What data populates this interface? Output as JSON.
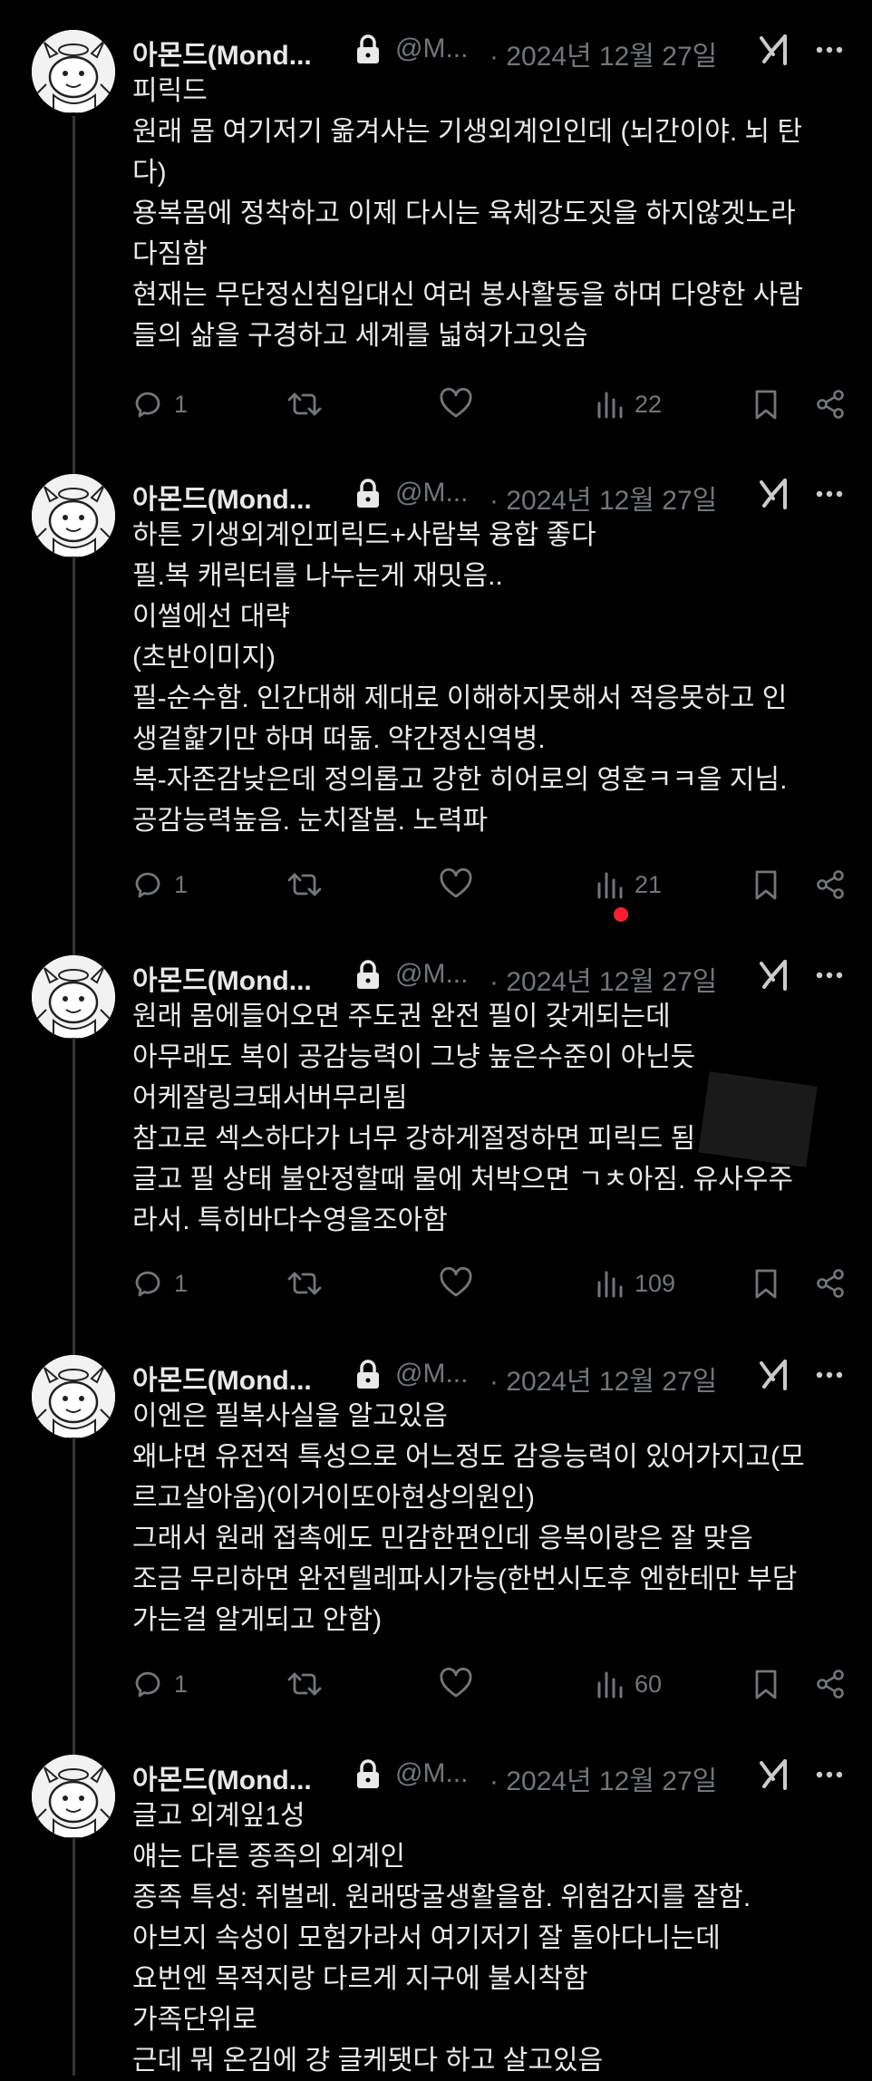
{
  "author": {
    "name": "아몬드(Mond...",
    "handle": "@M...",
    "date": "· 2024년 12월 27일"
  },
  "colors": {
    "background": "#000000",
    "text": "#e7e9ea",
    "muted": "#71767b",
    "thread_line": "#333639",
    "notification_dot": "#f4212e"
  },
  "icons": [
    "lock-icon",
    "grok-icon",
    "more-icon",
    "reply-icon",
    "repost-icon",
    "like-icon",
    "views-icon",
    "bookmark-icon",
    "share-icon"
  ],
  "posts": [
    {
      "lines": [
        "피릭드",
        "원래 몸 여기저기 옮겨사는 기생외계인인데 (뇌간이야. 뇌 탄",
        "다)",
        "용복몸에 정착하고 이제 다시는 육체강도짓을 하지않겟노라",
        "다짐함",
        "현재는 무단정신침입대신 여러 봉사활동을 하며 다양한 사람",
        "들의 삶을 구경하고 세계를 넓혀가고잇슴"
      ],
      "replies": "1",
      "views": "22"
    },
    {
      "lines": [
        "하튼 기생외계인피릭드+사람복 융합 좋다",
        "필.복 캐릭터를 나누는게 재밋음..",
        "이썰에선 대략",
        "(초반이미지)",
        "필-순수함. 인간대해 제대로 이해하지못해서 적응못하고 인",
        "생겉핥기만 하며 떠돎. 약간정신역병.",
        "복-자존감낮은데 정의롭고 강한 히어로의 영혼ㅋㅋ을 지님.",
        "공감능력높음. 눈치잘봄. 노력파"
      ],
      "replies": "1",
      "views": "21"
    },
    {
      "lines": [
        "원래 몸에들어오면 주도권 완전 필이 갖게되는데",
        "아무래도 복이 공감능력이 그냥 높은수준이 아닌듯",
        "어케잘링크돼서버무리됨",
        "참고로 섹스하다가 너무 강하게절정하면 피릭드             됨",
        "글고 필 상태 불안정할때 물에 처박으면 ㄱㅊ아짐. 유사우주",
        "라서. 특히바다수영을조아함"
      ],
      "replies": "1",
      "views": "109"
    },
    {
      "lines": [
        "이엔은 필복사실을 알고있음",
        "왜냐면 유전적 특성으로 어느정도 감응능력이 있어가지고(모",
        "르고살아옴)(이거이또아현상의원인)",
        "그래서 원래 접촉에도 민감한편인데 응복이랑은 잘 맞음",
        "조금 무리하면 완전텔레파시가능(한번시도후 엔한테만 부담",
        "가는걸 알게되고 안함)"
      ],
      "replies": "1",
      "views": "60"
    },
    {
      "lines": [
        "글고 외계잎1성",
        "얘는 다른 종족의 외계인",
        "종족 특성: 쥐벌레. 원래땅굴생활을함. 위험감지를 잘함.",
        "아브지 속성이 모험가라서 여기저기 잘 돌아다니는데",
        "요번엔 목적지랑 다르게 지구에 불시착함",
        "가족단위로",
        "근데 뭐 온김에 걍 글케됏다 하고 살고있음"
      ]
    }
  ]
}
